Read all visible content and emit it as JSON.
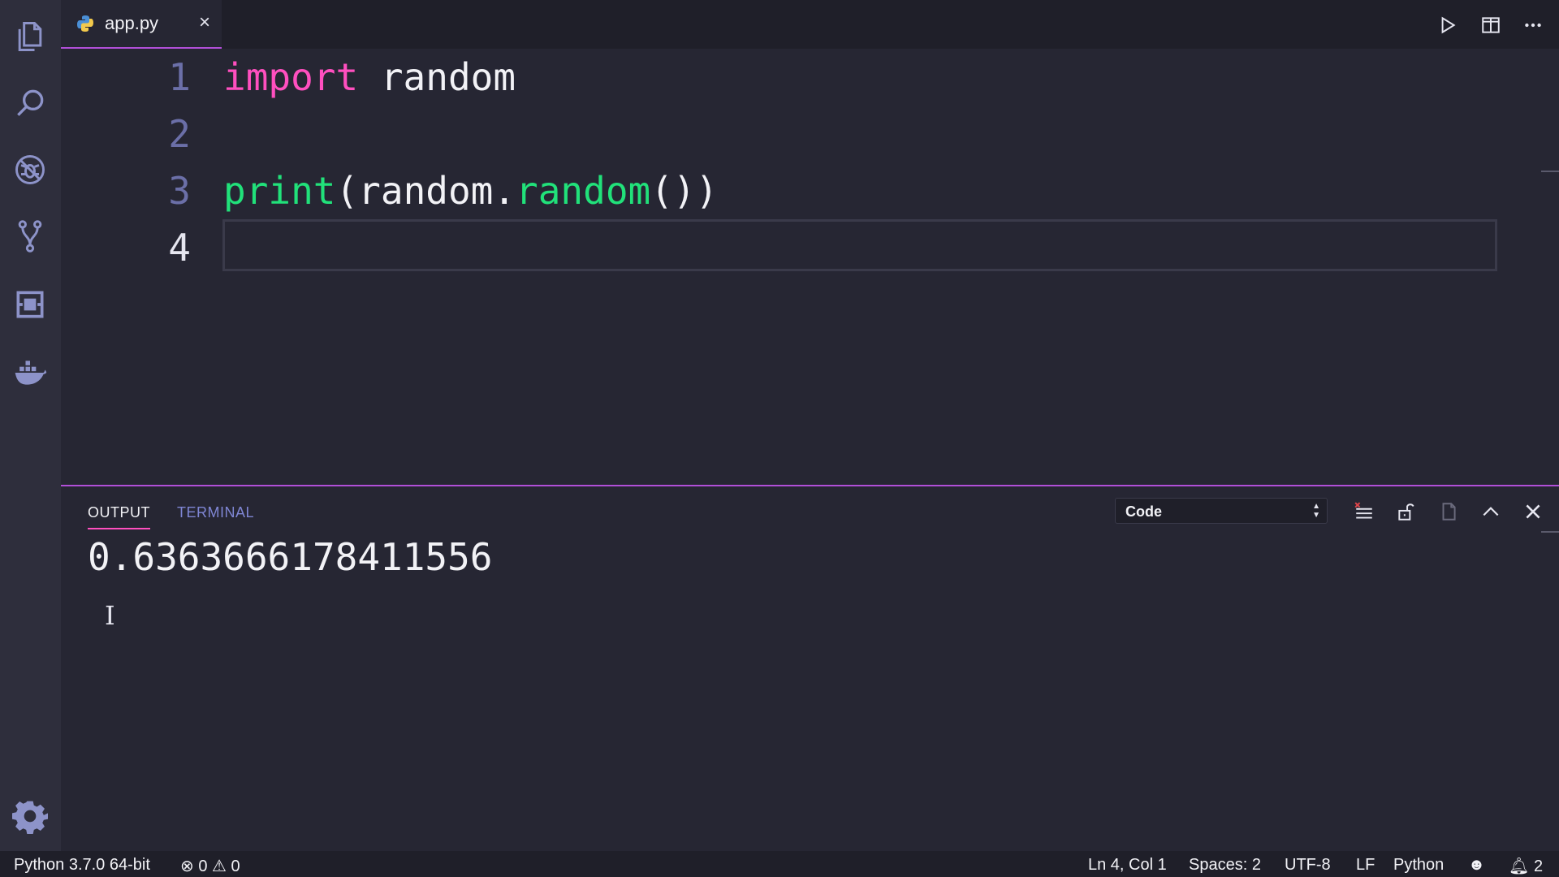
{
  "tab": {
    "filename": "app.py",
    "close": "×"
  },
  "editor": {
    "lines": [
      {
        "number": "1",
        "tokens": [
          {
            "t": "import",
            "c": "kw"
          },
          {
            "t": " random",
            "c": "txt"
          }
        ]
      },
      {
        "number": "2",
        "tokens": []
      },
      {
        "number": "3",
        "tokens": [
          {
            "t": "print",
            "c": "fn"
          },
          {
            "t": "(random.",
            "c": "txt"
          },
          {
            "t": "random",
            "c": "fn"
          },
          {
            "t": "())",
            "c": "txt"
          }
        ]
      },
      {
        "number": "4",
        "tokens": []
      }
    ]
  },
  "panel": {
    "tabs": {
      "output": "OUTPUT",
      "terminal": "TERMINAL"
    },
    "channel": "Code",
    "output_text": "0.6363666178411556",
    "cursor_glyph": "I"
  },
  "statusbar": {
    "interpreter": "Python 3.7.0 64-bit",
    "errors": "0",
    "warnings": "0",
    "position": "Ln 4, Col 1",
    "spaces": "Spaces: 2",
    "encoding": "UTF-8",
    "eol": "LF",
    "language": "Python",
    "notifications": "2"
  },
  "colors": {
    "accent": "#b14fd8",
    "keyword": "#ff4fbf",
    "function": "#21e17a",
    "inactive_tab": "#7f86d4"
  },
  "icons": {
    "activity": [
      "files-icon",
      "search-icon",
      "debug-icon",
      "source-control-icon",
      "extensions-icon",
      "docker-icon",
      "settings-gear-icon"
    ],
    "toolbar": [
      "run-icon",
      "split-editor-icon",
      "more-actions-icon"
    ],
    "panel": [
      "clear-output-icon",
      "lock-scroll-icon",
      "open-log-icon",
      "maximize-panel-icon",
      "close-panel-icon"
    ]
  }
}
